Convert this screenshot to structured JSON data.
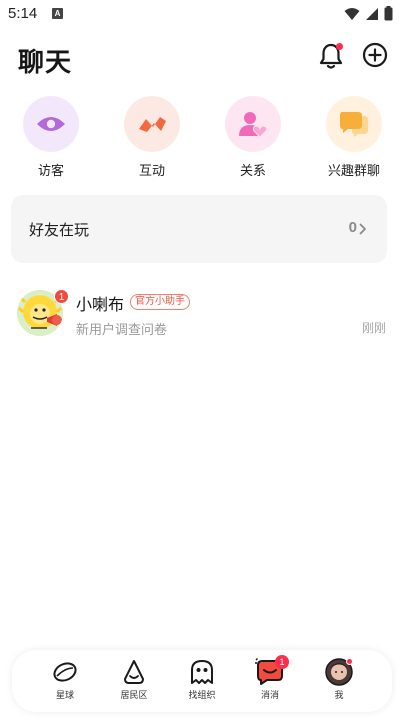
{
  "status_bar": {
    "time": "5:14",
    "a_icon": "A"
  },
  "header": {
    "title": "聊天"
  },
  "shortcuts": [
    {
      "label": "访客",
      "icon": "eye-icon",
      "bg": "#f3e8fb",
      "color": "#b26ad6"
    },
    {
      "label": "互动",
      "icon": "zigzag-icon",
      "bg": "#fde9e3",
      "color": "#f2683f"
    },
    {
      "label": "关系",
      "icon": "person-heart-icon",
      "bg": "#fde6f2",
      "color": "#f06ab7"
    },
    {
      "label": "兴趣群聊",
      "icon": "chat-bubbles-icon",
      "bg": "#fff1dd",
      "color": "#f7ae3a"
    }
  ],
  "friends_card": {
    "title": "好友在玩",
    "count": "0"
  },
  "conversations": [
    {
      "name": "小喇布",
      "tag": "官方小助手",
      "preview": "新用户调查问卷",
      "time": "刚刚",
      "badge": "1"
    }
  ],
  "tabbar": {
    "items": [
      {
        "label": "星球",
        "icon": "planet-icon"
      },
      {
        "label": "居民区",
        "icon": "house-icon"
      },
      {
        "label": "找组织",
        "icon": "ghost-icon"
      },
      {
        "label": "消消",
        "icon": "message-icon",
        "badge": "1"
      },
      {
        "label": "我",
        "icon": "avatar-icon"
      }
    ]
  }
}
